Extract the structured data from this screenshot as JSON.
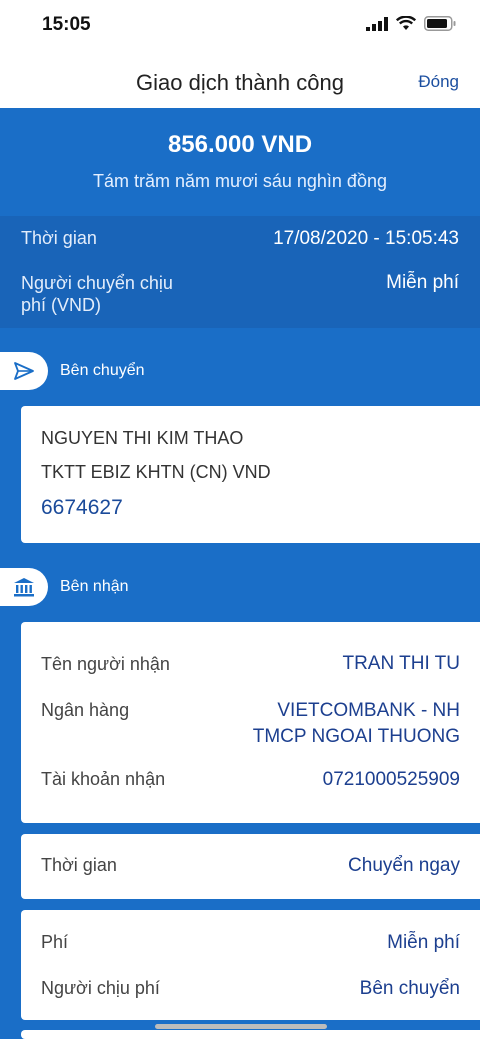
{
  "status_bar": {
    "time": "15:05"
  },
  "nav": {
    "title": "Giao dịch thành công",
    "close_label": "Đóng"
  },
  "amount": {
    "value": "856.000 VND",
    "words": "Tám trăm năm mươi sáu nghìn đồng"
  },
  "info": {
    "time_label": "Thời gian",
    "time_value": "17/08/2020 - 15:05:43",
    "fee_payer_label_line1": "Người chuyển chịu",
    "fee_payer_label_line2": "phí (VND)",
    "fee_payer_value": "Miễn phí"
  },
  "sender": {
    "section_label": "Bên chuyển",
    "name": "NGUYEN THI KIM THAO",
    "account_type": "TKTT EBIZ KHTN (CN) VND",
    "account_number": "6674627"
  },
  "receiver": {
    "section_label": "Bên nhận",
    "name_label": "Tên người nhận",
    "name_value": "TRAN THI TU",
    "bank_label": "Ngân hàng",
    "bank_value_line1": "VIETCOMBANK - NH",
    "bank_value_line2": "TMCP NGOAI THUONG",
    "account_label": "Tài khoản nhận",
    "account_value": "0721000525909"
  },
  "timing": {
    "label": "Thời gian",
    "value": "Chuyển ngay"
  },
  "fee": {
    "fee_label": "Phí",
    "fee_value": "Miễn phí",
    "payer_label": "Người chịu phí",
    "payer_value": "Bên chuyển"
  },
  "colors": {
    "primary": "#1a6ec7",
    "primary_dark": "#1964b8",
    "link": "#1c4fa0"
  }
}
